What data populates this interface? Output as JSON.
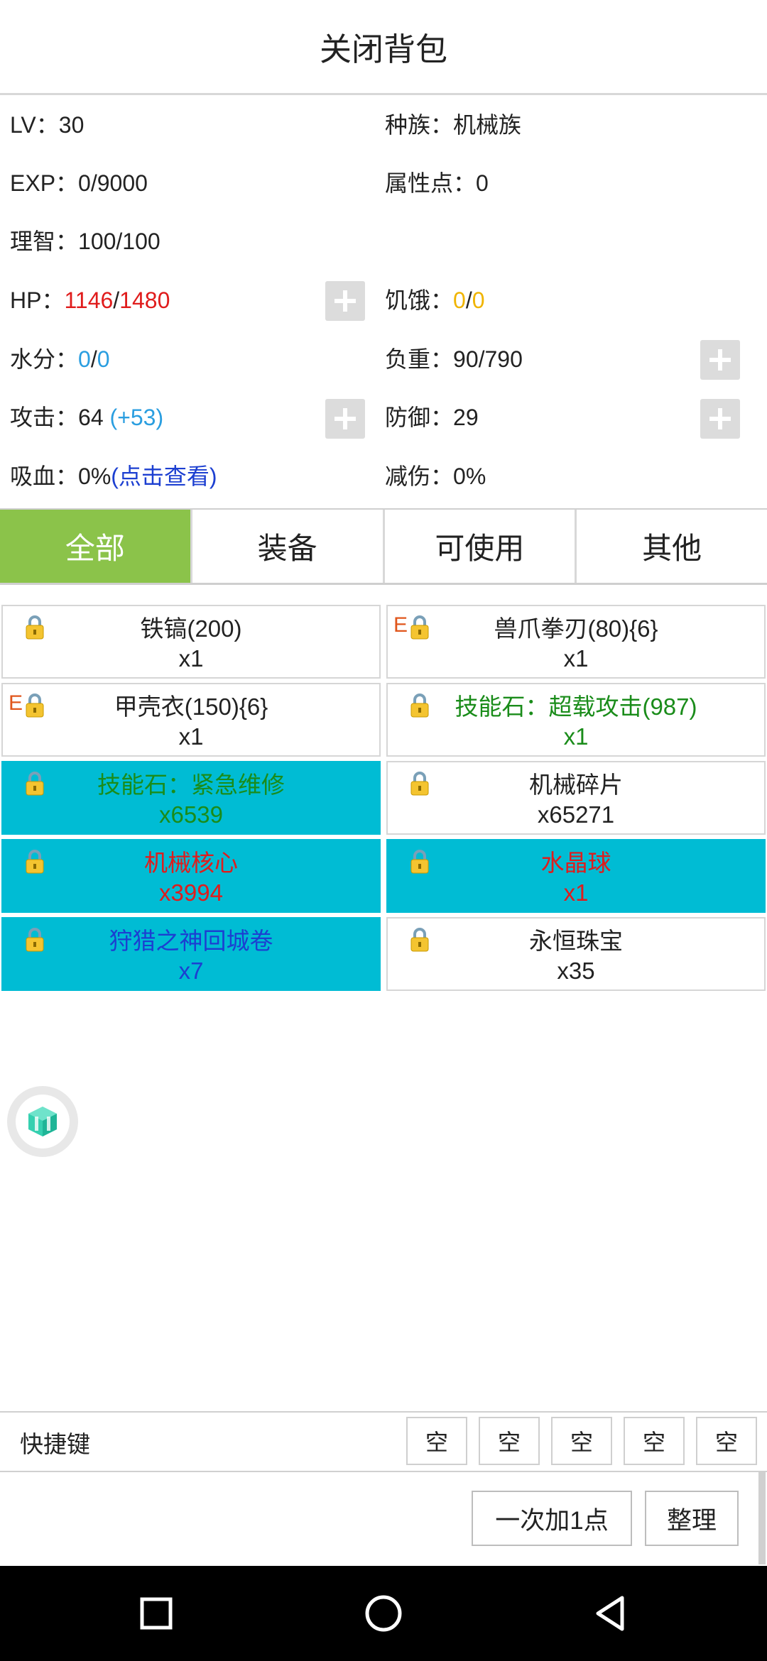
{
  "header": {
    "title": "关闭背包"
  },
  "stats": {
    "lv": {
      "label": "LV：",
      "value": "30"
    },
    "race": {
      "label": "种族：",
      "value": "机械族"
    },
    "exp": {
      "label": "EXP：",
      "value": "0/9000"
    },
    "attr_points": {
      "label": "属性点：",
      "value": "0"
    },
    "sanity": {
      "label": "理智：",
      "value": "100/100"
    },
    "hp": {
      "label": "HP：",
      "current": "1146",
      "sep": "/",
      "max": "1480"
    },
    "hunger": {
      "label": "饥饿：",
      "current": "0",
      "sep": "/",
      "max": "0"
    },
    "water": {
      "label": "水分：",
      "current": "0",
      "sep": "/",
      "max": "0"
    },
    "load": {
      "label": "负重：",
      "value": "90/790"
    },
    "attack": {
      "label": "攻击：",
      "value": "64 ",
      "bonus": "(+53)"
    },
    "defense": {
      "label": "防御：",
      "value": "29"
    },
    "lifesteal": {
      "label": "吸血：",
      "value": "0%",
      "link": "(点击查看)"
    },
    "damage_reduction": {
      "label": "减伤：",
      "value": "0%"
    }
  },
  "tabs": [
    {
      "label": "全部",
      "active": true
    },
    {
      "label": "装备",
      "active": false
    },
    {
      "label": "可使用",
      "active": false
    },
    {
      "label": "其他",
      "active": false
    }
  ],
  "items": [
    {
      "name": "铁镐(200)",
      "qty": "x1",
      "equipped": false,
      "e": "",
      "color": "black",
      "bg": "white"
    },
    {
      "name": "兽爪拳刃(80){6}",
      "qty": "x1",
      "equipped": true,
      "e": "E",
      "color": "black",
      "bg": "white"
    },
    {
      "name": "甲壳衣(150){6}",
      "qty": "x1",
      "equipped": true,
      "e": "E",
      "color": "black",
      "bg": "white"
    },
    {
      "name": "技能石：超载攻击(987)",
      "qty": "x1",
      "equipped": false,
      "e": "",
      "color": "green",
      "bg": "white"
    },
    {
      "name": "技能石：紧急维修",
      "qty": "x6539",
      "equipped": false,
      "e": "",
      "color": "green",
      "bg": "cyan"
    },
    {
      "name": "机械碎片",
      "qty": "x65271",
      "equipped": false,
      "e": "",
      "color": "black",
      "bg": "white"
    },
    {
      "name": "机械核心",
      "qty": "x3994",
      "equipped": false,
      "e": "",
      "color": "red",
      "bg": "cyan"
    },
    {
      "name": "水晶球",
      "qty": "x1",
      "equipped": false,
      "e": "",
      "color": "red",
      "bg": "cyan"
    },
    {
      "name": "狩猎之神回城卷",
      "qty": "x7",
      "equipped": false,
      "e": "",
      "color": "blue",
      "bg": "cyan"
    },
    {
      "name": "永恒珠宝",
      "qty": "x35",
      "equipped": false,
      "e": "",
      "color": "black",
      "bg": "white"
    }
  ],
  "hotkeys": {
    "label": "快捷键",
    "slots": [
      "空",
      "空",
      "空",
      "空",
      "空"
    ]
  },
  "actions": {
    "add_one_point": "一次加1点",
    "sort": "整理"
  },
  "colors": {
    "tab_active": "#8bc34a",
    "item_highlight": "#00bcd4",
    "hp_red": "#e01c1c",
    "water_blue": "#2a9ee0",
    "hunger_yellow": "#f0b400",
    "link_blue": "#1c3fd1"
  },
  "icons": {
    "plus": "plus-icon",
    "lock": "lock-icon",
    "cube": "cube-icon",
    "nav_recent": "square-icon",
    "nav_home": "circle-icon",
    "nav_back": "triangle-back-icon"
  }
}
